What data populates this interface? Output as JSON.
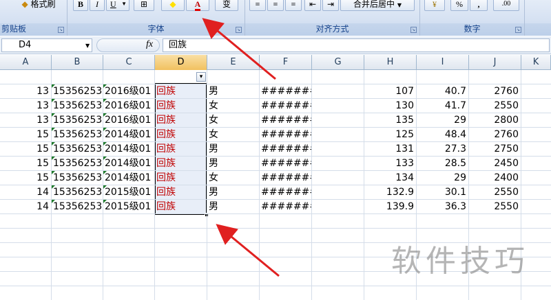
{
  "ribbon": {
    "format_painter_label": "格式刷",
    "clipboard_label": "剪贴板",
    "font_label": "字体",
    "alignment_label": "对齐方式",
    "number_label": "数字",
    "bold_label": "B",
    "italic_label": "I",
    "underline_label": "U",
    "font_color_label": "A",
    "phonetic_label": "变",
    "merge_label": "合并后居中",
    "percent_label": "%",
    "comma_label": ",",
    "decimal_label": ".00"
  },
  "formula_bar": {
    "name_box": "D4",
    "fx_label": "fx",
    "formula": "回族"
  },
  "columns": [
    "A",
    "B",
    "C",
    "D",
    "E",
    "F",
    "G",
    "H",
    "I",
    "J",
    "K"
  ],
  "selected_column": "D",
  "rows": [
    {
      "a": "13",
      "b": "15356253",
      "c": "2016级01",
      "d": "回族",
      "e": "男",
      "f": "########",
      "h": "107",
      "i": "40.7",
      "j": "2760"
    },
    {
      "a": "13",
      "b": "15356253",
      "c": "2016级01",
      "d": "回族",
      "e": "女",
      "f": "########",
      "h": "130",
      "i": "41.7",
      "j": "2550"
    },
    {
      "a": "13",
      "b": "15356253",
      "c": "2016级01",
      "d": "回族",
      "e": "女",
      "f": "########",
      "h": "135",
      "i": "29",
      "j": "2800"
    },
    {
      "a": "15",
      "b": "15356253",
      "c": "2014级01",
      "d": "回族",
      "e": "女",
      "f": "########",
      "h": "125",
      "i": "48.4",
      "j": "2760"
    },
    {
      "a": "15",
      "b": "15356253",
      "c": "2014级01",
      "d": "回族",
      "e": "男",
      "f": "########",
      "h": "131",
      "i": "27.3",
      "j": "2750"
    },
    {
      "a": "15",
      "b": "15356253",
      "c": "2014级01",
      "d": "回族",
      "e": "男",
      "f": "########",
      "h": "133",
      "i": "28.5",
      "j": "2450"
    },
    {
      "a": "15",
      "b": "15356253",
      "c": "2014级01",
      "d": "回族",
      "e": "女",
      "f": "########",
      "h": "134",
      "i": "29",
      "j": "2400"
    },
    {
      "a": "14",
      "b": "15356253",
      "c": "2015级01",
      "d": "回族",
      "e": "男",
      "f": "########",
      "h": "132.9",
      "i": "30.1",
      "j": "2550"
    },
    {
      "a": "14",
      "b": "15356253",
      "c": "2015级01",
      "d": "回族",
      "e": "男",
      "f": "########",
      "h": "139.9",
      "i": "36.3",
      "j": "2550"
    }
  ],
  "watermark": "软件技巧",
  "colors": {
    "selected_header": "#f1c15f",
    "red_text": "#c00000",
    "annotation_arrow": "#e02020"
  }
}
